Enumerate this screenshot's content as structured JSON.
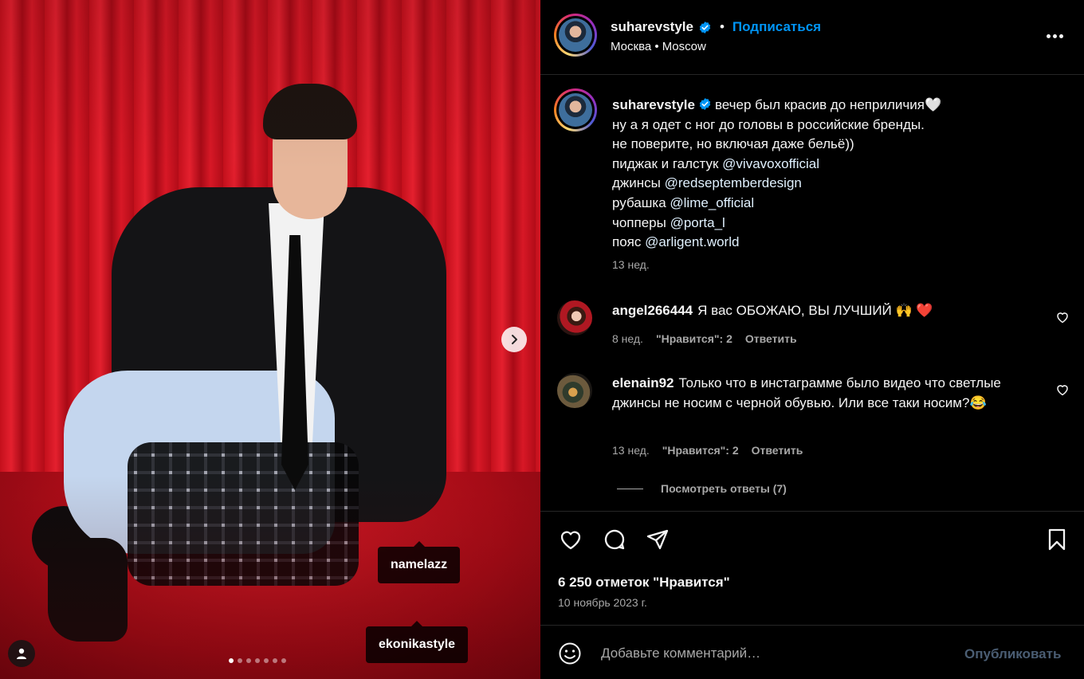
{
  "media": {
    "tags": [
      "namelazz",
      "ekonikastyle"
    ],
    "carousel_count": 7,
    "carousel_active_index": 0,
    "next_icon": "chevron-right-icon",
    "user_tags_icon": "person-icon"
  },
  "header": {
    "username": "suharevstyle",
    "follow_label": "Подписаться",
    "location": "Москва • Moscow",
    "more_icon": "more-horizontal-icon"
  },
  "caption": {
    "username": "suharevstyle",
    "lines": [
      "вечер был красив до неприличия🤍",
      "ну а я одет с ног до головы в российские бренды.",
      "не поверите, но включая даже бельё))"
    ],
    "credits": [
      {
        "prefix": "пиджак и галстук ",
        "mention": "@vivavoxofficial"
      },
      {
        "prefix": "джинсы ",
        "mention": "@redseptemberdesign"
      },
      {
        "prefix": "рубашка ",
        "mention": "@lime_official"
      },
      {
        "prefix": "чопперы ",
        "mention": "@porta_l"
      },
      {
        "prefix": "пояс ",
        "mention": "@arligent.world"
      }
    ],
    "time": "13 нед."
  },
  "comments": [
    {
      "username": "angel266444",
      "text": "Я вас ОБОЖАЮ, ВЫ ЛУЧШИЙ 🙌 ❤️",
      "time": "8 нед.",
      "likes": "\"Нравится\": 2",
      "reply": "Ответить"
    },
    {
      "username": "elenain92",
      "text": "Только что в инстаграмме было видео что светлые джинсы не носим с черной обувью. Или все таки носим?😂",
      "time": "13 нед.",
      "likes": "\"Нравится\": 2",
      "reply": "Ответить",
      "view_replies": "Посмотреть ответы (7)"
    }
  ],
  "actions": {
    "like_icon": "heart-icon",
    "comment_icon": "comment-icon",
    "share_icon": "share-icon",
    "save_icon": "bookmark-icon",
    "likes": "6 250 отметок \"Нравится\"",
    "date": "10 ноябрь 2023 г."
  },
  "add_comment": {
    "placeholder": "Добавьте комментарий…",
    "publish_label": "Опубликовать",
    "emoji_icon": "emoji-icon"
  },
  "colors": {
    "accent": "#0095f6",
    "background": "#000000",
    "secondary_text": "#a8a8a8"
  }
}
